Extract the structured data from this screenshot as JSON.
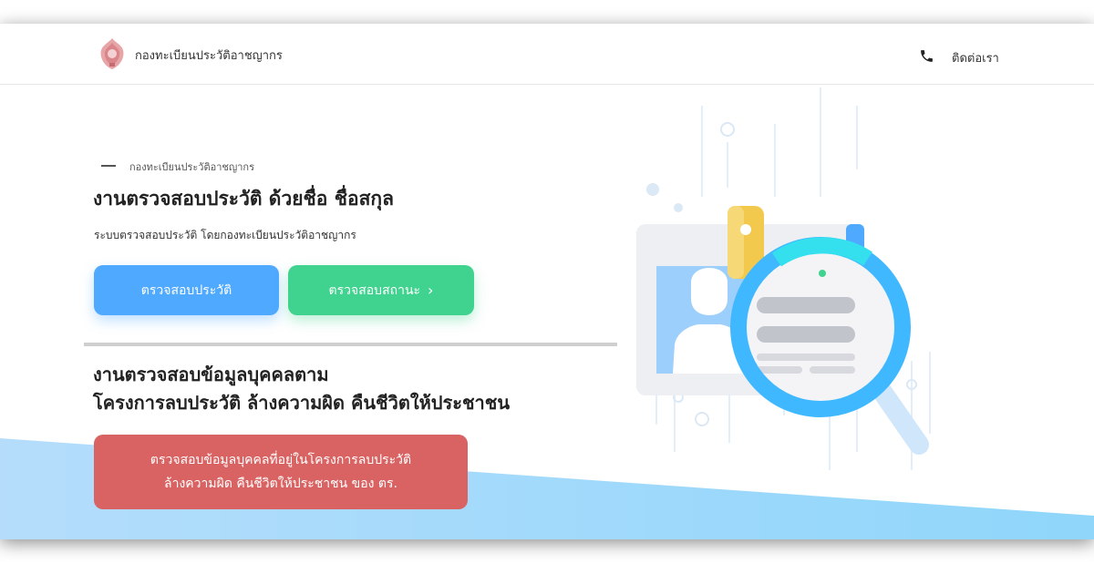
{
  "header": {
    "brand": "กองทะเบียนประวัติอาชญากร",
    "contact_label": "ติดต่อเรา",
    "phone_icon": "phone-icon"
  },
  "hero": {
    "eyebrow": "กองทะเบียนประวัติอาชญากร",
    "title": "งานตรวจสอบประวัติ ด้วยชื่อ ชื่อสกุล",
    "subtitle": "ระบบตรวจสอบประวัติ โดยกองทะเบียนประวัติอาชญากร",
    "check_history_label": "ตรวจสอบประวัติ",
    "check_status_label": "ตรวจสอบสถานะ",
    "chevron": "›"
  },
  "section2": {
    "title_line1": "งานตรวจสอบข้อมูลบุคคลตาม",
    "title_line2": "โครงการลบประวัติ ล้างความผิด คืนชีวิตให้ประชาชน",
    "button_line1": "ตรวจสอบข้อมูลบุคคลที่อยู่ในโครงการลบประวัติ",
    "button_line2": "ล้างความผิด คืนชีวิตให้ประชาชน ของ ตร."
  },
  "colors": {
    "blue": "#4ea9ff",
    "green": "#3fd38f",
    "red": "#d96363",
    "wave": "#9dd8fb"
  }
}
